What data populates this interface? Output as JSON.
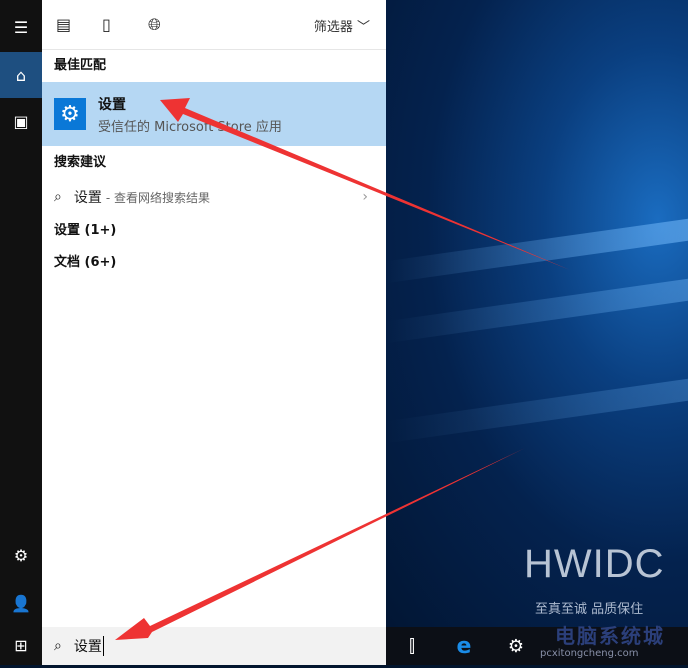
{
  "header": {
    "icons": [
      "news-icon",
      "document-icon",
      "globe-icon"
    ],
    "filter_label": "筛选器"
  },
  "sidebar": {
    "icons": [
      "menu-icon",
      "home-icon",
      "notebook-icon",
      "settings-icon",
      "user-icon",
      "windows-start-icon"
    ]
  },
  "best_match": {
    "heading": "最佳匹配",
    "title": "设置",
    "subtitle": "受信任的 Microsoft Store 应用"
  },
  "suggestions": {
    "heading": "搜索建议",
    "item": "设置",
    "item_sub": "- 查看网络搜索结果"
  },
  "groups": [
    {
      "label": "设置 (1+)"
    },
    {
      "label": "文档 (6+)"
    }
  ],
  "search": {
    "value": "设置"
  },
  "watermark": {
    "brand": "HWIDC",
    "slogan": "至真至诚 品质保住",
    "site": "电脑系统城",
    "url": "pcxitongcheng.com"
  },
  "colors": {
    "accent": "#0a78d7",
    "selection": "#b5d7f3",
    "arrow": "#ee3333"
  }
}
